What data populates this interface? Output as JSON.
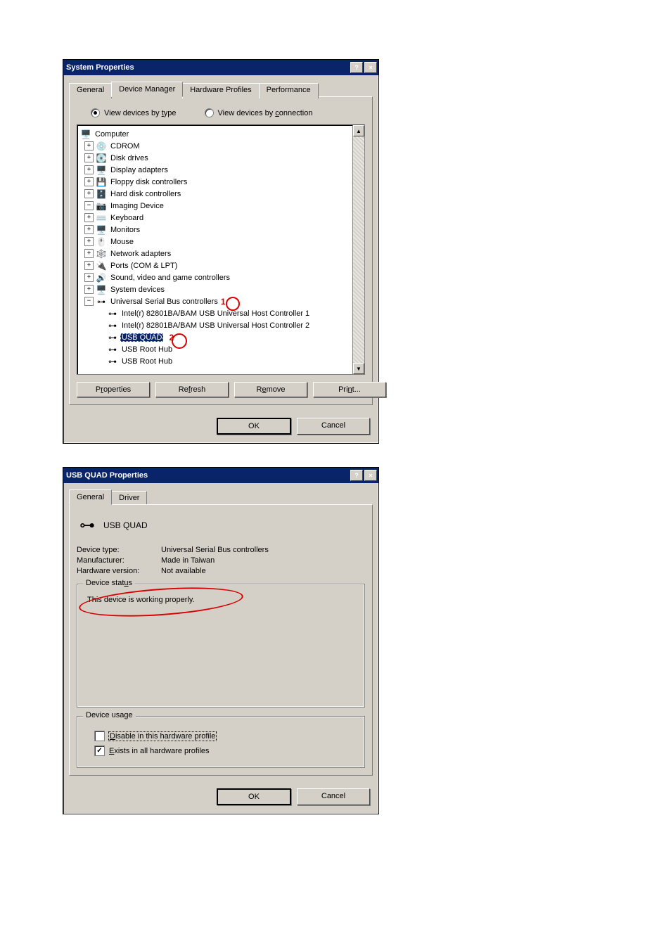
{
  "sysprops": {
    "title": "System Properties",
    "tabs": {
      "general": "General",
      "devmgr": "Device Manager",
      "hwprof": "Hardware Profiles",
      "perf": "Performance"
    },
    "radio": {
      "by_type": "View devices by type",
      "by_conn": "View devices by connection"
    },
    "underline": {
      "by_type_char": "t",
      "by_conn_char": "c"
    },
    "tree": {
      "root": "Computer",
      "items": [
        {
          "label": "CDROM",
          "exp": "+"
        },
        {
          "label": "Disk drives",
          "exp": "+"
        },
        {
          "label": "Display adapters",
          "exp": "+"
        },
        {
          "label": "Floppy disk controllers",
          "exp": "+"
        },
        {
          "label": "Hard disk controllers",
          "exp": "+"
        },
        {
          "label": "Imaging Device",
          "exp": "−"
        },
        {
          "label": "Keyboard",
          "exp": "+"
        },
        {
          "label": "Monitors",
          "exp": "+"
        },
        {
          "label": "Mouse",
          "exp": "+"
        },
        {
          "label": "Network adapters",
          "exp": "+"
        },
        {
          "label": "Ports (COM & LPT)",
          "exp": "+"
        },
        {
          "label": "Sound, video and game controllers",
          "exp": "+"
        },
        {
          "label": "System devices",
          "exp": "+"
        },
        {
          "label": "Universal Serial Bus controllers",
          "exp": "−"
        }
      ],
      "usb_children": [
        "Intel(r) 82801BA/BAM USB Universal Host Controller 1",
        "Intel(r) 82801BA/BAM USB Universal Host Controller 2",
        "USB QUAD",
        "USB Root Hub",
        "USB Root Hub"
      ]
    },
    "buttons": {
      "properties": "Properties",
      "refresh": "Refresh",
      "remove": "Remove",
      "print": "Print..."
    },
    "footer": {
      "ok": "OK",
      "cancel": "Cancel"
    },
    "annot": {
      "one": "1",
      "two": "2"
    }
  },
  "usbprops": {
    "title": "USB QUAD Properties",
    "tabs": {
      "general": "General",
      "driver": "Driver"
    },
    "device_name": "USB QUAD",
    "rows": {
      "type_label": "Device type:",
      "type_value": "Universal Serial Bus controllers",
      "mfr_label": "Manufacturer:",
      "mfr_value": "Made in Taiwan",
      "hw_label": "Hardware version:",
      "hw_value": "Not available"
    },
    "status_group": "Device status",
    "status_text": "This device is working properly.",
    "usage_group": "Device usage",
    "disable_label": "Disable in this hardware profile",
    "exists_label": "Exists in all hardware profiles",
    "footer": {
      "ok": "OK",
      "cancel": "Cancel"
    }
  }
}
